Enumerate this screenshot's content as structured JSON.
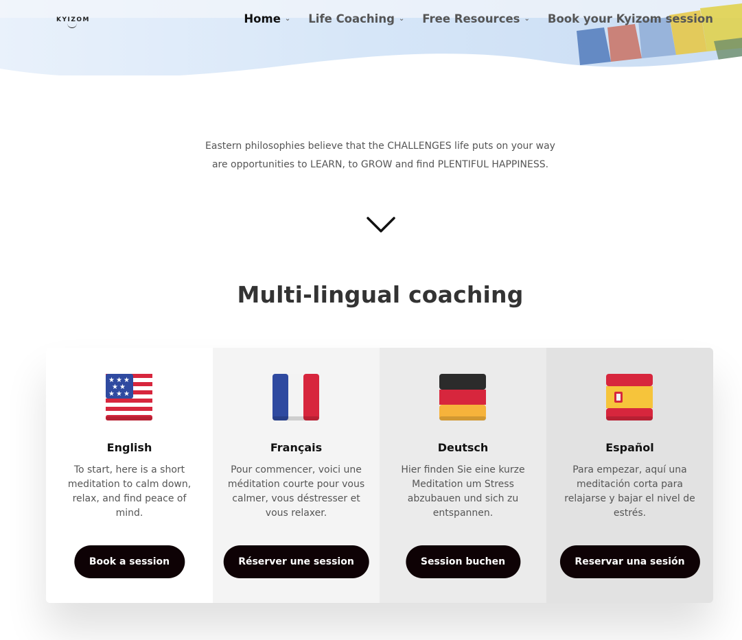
{
  "header": {
    "logo_text": "KYIZOM",
    "nav": [
      {
        "label": "Home",
        "has_dropdown": true,
        "active": true
      },
      {
        "label": "Life Coaching",
        "has_dropdown": true,
        "active": false
      },
      {
        "label": "Free Resources",
        "has_dropdown": true,
        "active": false
      },
      {
        "label": "Book your Kyizom session",
        "has_dropdown": false,
        "active": false
      }
    ]
  },
  "intro": {
    "line1": "Eastern philosophies believe that the CHALLENGES life puts on your way",
    "line2": "are opportunities to LEARN, to GROW and find PLENTIFUL HAPPINESS."
  },
  "section": {
    "title": "Multi-lingual coaching"
  },
  "cards": [
    {
      "flag": "usa-flag-icon",
      "language": "English",
      "description": "To start, here is a short meditation to calm down, relax, and find peace of mind.",
      "button": "Book a session",
      "bg": "#ffffff"
    },
    {
      "flag": "france-flag-icon",
      "language": "Français",
      "description": "Pour commencer, voici une méditation courte pour vous calmer, vous déstresser et vous relaxer.",
      "button": "Réserver une session",
      "bg": "#f4f4f4"
    },
    {
      "flag": "germany-flag-icon",
      "language": "Deutsch",
      "description": "Hier finden Sie eine kurze Meditation um Stress abzubauen und sich zu entspannen.",
      "button": "Session buchen",
      "bg": "#ebebeb"
    },
    {
      "flag": "spain-flag-icon",
      "language": "Español",
      "description": "Para empezar, aquí una meditación corta para relajarse y bajar el nivel de estrés.",
      "button": "Reservar una sesión",
      "bg": "#e2e2e2"
    }
  ],
  "colors": {
    "button_bg": "#0e0205",
    "button_text": "#ffffff",
    "title_text": "#333333"
  }
}
